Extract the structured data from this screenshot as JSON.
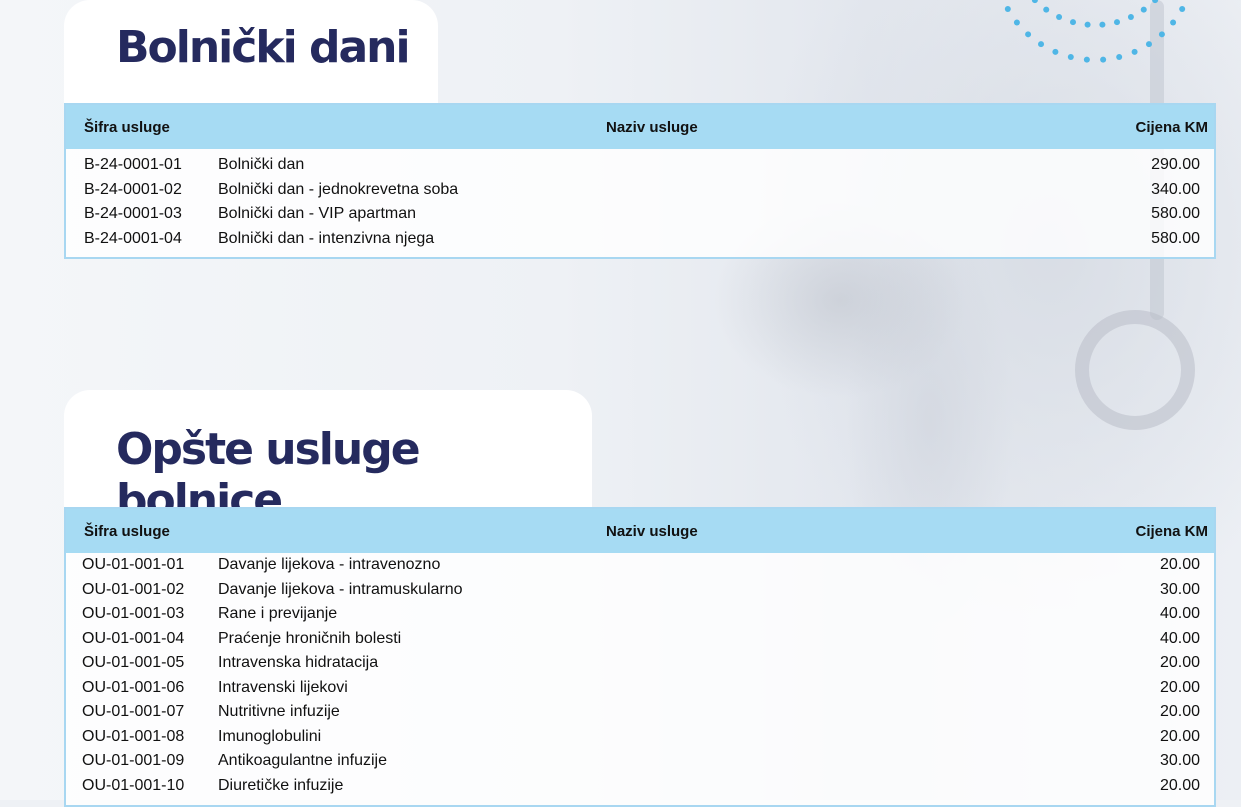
{
  "sections": [
    {
      "title": "Bolnički dani",
      "headers": {
        "code": "Šifra usluge",
        "name": "Naziv usluge",
        "price": "Cijena KM"
      },
      "rows": [
        {
          "code": "B-24-0001-01",
          "name": "Bolnički dan",
          "price": "290.00"
        },
        {
          "code": "B-24-0001-02",
          "name": "Bolnički dan - jednokrevetna soba",
          "price": "340.00"
        },
        {
          "code": "B-24-0001-03",
          "name": "Bolnički dan - VIP apartman",
          "price": "580.00"
        },
        {
          "code": "B-24-0001-04",
          "name": "Bolnički dan - intenzivna njega",
          "price": "580.00"
        }
      ]
    },
    {
      "title": "Opšte usluge bolnice",
      "headers": {
        "code": "Šifra usluge",
        "name": "Naziv usluge",
        "price": "Cijena KM"
      },
      "rows": [
        {
          "code": "OU-01-001-01",
          "name": "Davanje lijekova - intravenozno",
          "price": "20.00"
        },
        {
          "code": "OU-01-001-02",
          "name": "Davanje lijekova - intramuskularno",
          "price": "30.00"
        },
        {
          "code": "OU-01-001-03",
          "name": "Rane i previjanje",
          "price": "40.00"
        },
        {
          "code": "OU-01-001-04",
          "name": "Praćenje hroničnih bolesti",
          "price": "40.00"
        },
        {
          "code": "OU-01-001-05",
          "name": "Intravenska hidratacija",
          "price": "20.00"
        },
        {
          "code": "OU-01-001-06",
          "name": "Intravenski lijekovi",
          "price": "20.00"
        },
        {
          "code": "OU-01-001-07",
          "name": "Nutritivne infuzije",
          "price": "20.00"
        },
        {
          "code": "OU-01-001-08",
          "name": "Imunoglobulini",
          "price": "20.00"
        },
        {
          "code": "OU-01-001-09",
          "name": "Antikoagulantne infuzije",
          "price": "30.00"
        },
        {
          "code": "OU-01-001-10",
          "name": "Diuretičke infuzije",
          "price": "20.00"
        }
      ]
    }
  ],
  "colors": {
    "title": "#252a5e",
    "header_bg": "#a6dbf3",
    "border": "#a8d7f1",
    "dots": "#4fb6e6"
  }
}
